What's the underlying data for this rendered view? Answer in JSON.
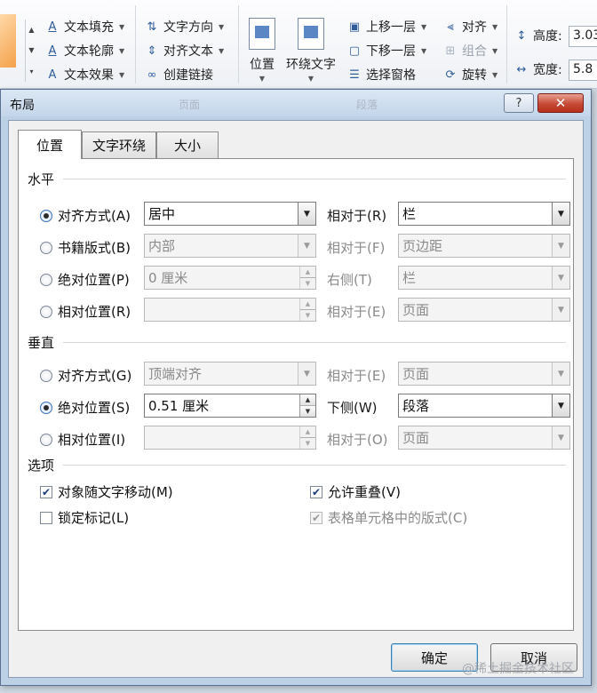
{
  "ribbon": {
    "text_fill": "文本填充",
    "text_outline": "文本轮廓",
    "text_effects": "文本效果",
    "text_direction": "文字方向",
    "align_text": "对齐文本",
    "create_link": "创建链接",
    "position": "位置",
    "wrap_text": "环绕文字",
    "bring_forward": "上移一层",
    "send_backward": "下移一层",
    "selection_pane": "选择窗格",
    "align": "对齐",
    "group": "组合",
    "rotate": "旋转",
    "height_label": "高度:",
    "height_value": "3.03",
    "width_label": "宽度:",
    "width_value": "5.8"
  },
  "dialog": {
    "title": "布局",
    "faint_title_1": "页面",
    "faint_title_2": "段落",
    "help_label": "?",
    "close_label": "✕",
    "tabs": [
      "位置",
      "文字环绕",
      "大小"
    ],
    "horizontal": {
      "section_label": "水平",
      "align_label": "对齐方式(A)",
      "align_value": "居中",
      "align_relative_label": "相对于(R)",
      "align_relative_value": "栏",
      "book_label": "书籍版式(B)",
      "book_value": "内部",
      "book_relative_label": "相对于(F)",
      "book_relative_value": "页边距",
      "absolute_label": "绝对位置(P)",
      "absolute_value": "0 厘米",
      "absolute_right_label": "右侧(T)",
      "absolute_right_value": "栏",
      "relative_label": "相对位置(R)",
      "relative_value": "",
      "relative_relative_label": "相对于(E)",
      "relative_relative_value": "页面"
    },
    "vertical": {
      "section_label": "垂直",
      "align_label": "对齐方式(G)",
      "align_value": "顶端对齐",
      "align_relative_label": "相对于(E)",
      "align_relative_value": "页面",
      "absolute_label": "绝对位置(S)",
      "absolute_value": "0.51 厘米",
      "absolute_below_label": "下侧(W)",
      "absolute_below_value": "段落",
      "relative_label": "相对位置(I)",
      "relative_value": "",
      "relative_relative_label": "相对于(O)",
      "relative_relative_value": "页面"
    },
    "options": {
      "section_label": "选项",
      "move_with_text": "对象随文字移动(M)",
      "lock_anchor": "锁定标记(L)",
      "allow_overlap": "允许重叠(V)",
      "layout_in_cell": "表格单元格中的版式(C)"
    },
    "ok_label": "确定",
    "cancel_label": "取消"
  },
  "watermark": "@稀土掘金技术社区"
}
